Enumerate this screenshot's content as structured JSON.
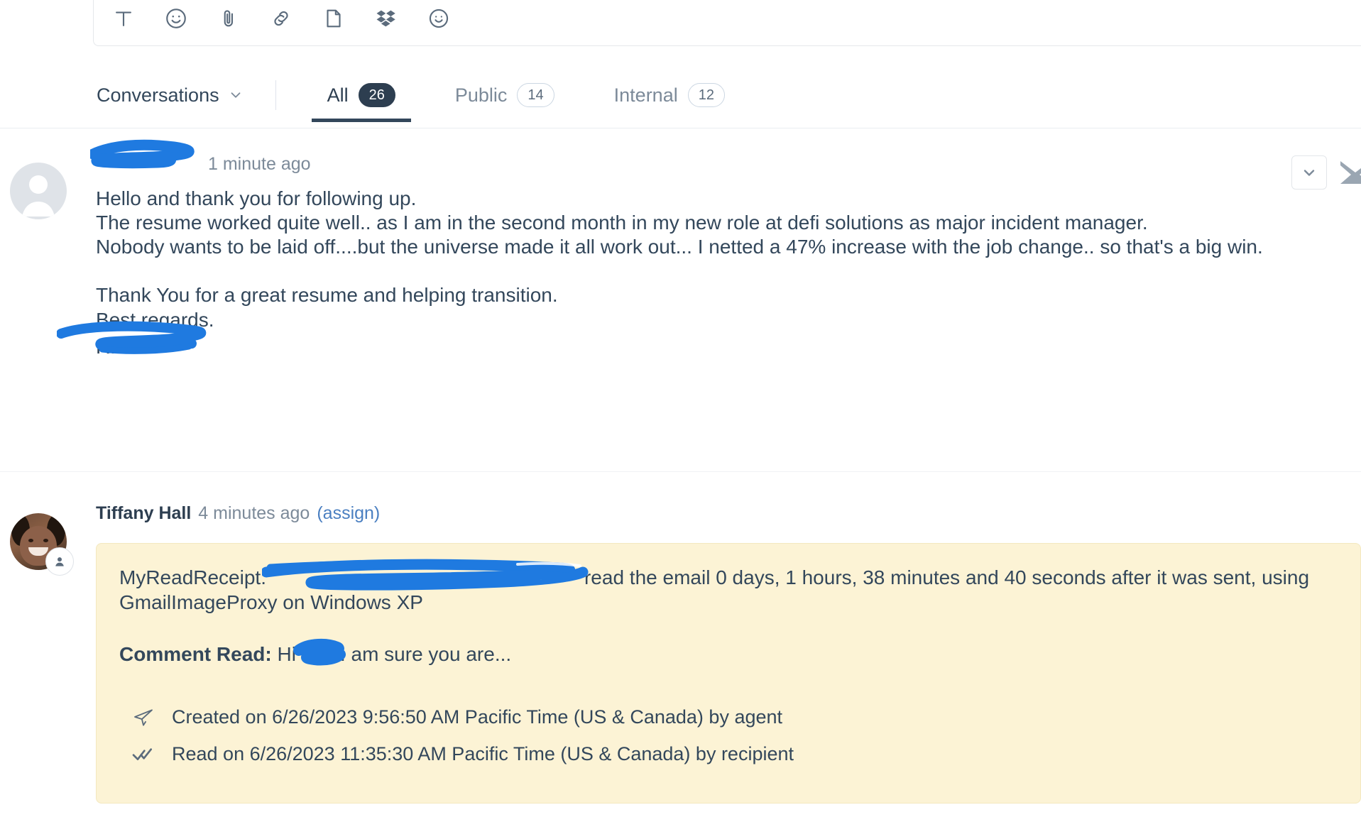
{
  "editor_toolbar": {
    "tools": [
      {
        "name": "text-format-icon",
        "label": "Text format"
      },
      {
        "name": "emoji-icon",
        "label": "Emoji"
      },
      {
        "name": "attachment-icon",
        "label": "Attach file"
      },
      {
        "name": "link-icon",
        "label": "Insert link"
      },
      {
        "name": "document-icon",
        "label": "Insert document"
      },
      {
        "name": "dropbox-icon",
        "label": "Dropbox"
      },
      {
        "name": "smiley-icon",
        "label": "Insert meeting link"
      }
    ]
  },
  "tabbar": {
    "conversations_label": "Conversations",
    "chevron": "chevron-down-icon",
    "tabs": [
      {
        "label": "All",
        "count": "26",
        "active": true
      },
      {
        "label": "Public",
        "count": "14",
        "active": false
      },
      {
        "label": "Internal",
        "count": "12",
        "active": false
      }
    ]
  },
  "messages": [
    {
      "author": "",
      "author_redacted": true,
      "time": "1 minute ago",
      "avatar": "generic-avatar-icon",
      "lines": [
        "Hello and thank you for following up.",
        "The resume worked quite well.. as I am in the second month in my new role at defi solutions as major incident manager.",
        "Nobody wants to be laid off....but the universe made it all work out... I netted a 47% increase with the job change.. so that's a big win.",
        "",
        "Thank You for a great resume and helping transition.",
        "Best regards."
      ],
      "signature_redacted": true,
      "signature_text": "R...",
      "actions": {
        "expand": "chevron-down-icon",
        "email": "envelope-icon"
      }
    },
    {
      "author": "Tiffany Hall",
      "time": "4 minutes ago",
      "assign_label": "(assign)",
      "avatar": "agent-photo-avatar",
      "avatar_badge": "contact-badge-icon",
      "note": {
        "receipt_prefix": "MyReadReceipt:",
        "receipt_suffix": "read the email 0 days, 1 hours, 38 minutes and 40 seconds after it was sent, using GmailImageProxy on Windows XP",
        "comment_label": "Comment Read:",
        "comment_prefix": "Hi",
        "comment_suffix": "I am sure you are...",
        "events": [
          {
            "icon": "paper-plane-icon",
            "text": "Created on 6/26/2023 9:56:50 AM Pacific Time (US & Canada) by agent"
          },
          {
            "icon": "double-check-icon",
            "text": "Read on 6/26/2023 11:35:30 AM Pacific Time (US & Canada) by recipient"
          }
        ]
      }
    }
  ],
  "colors": {
    "note_background": "#fcf3d5",
    "note_border": "#f3e8bf",
    "redaction_marker": "#1f7ae0",
    "active_tab": "#33475b",
    "link": "#4a7fc1",
    "text": "#33475b",
    "muted_text": "#7c8a99"
  }
}
